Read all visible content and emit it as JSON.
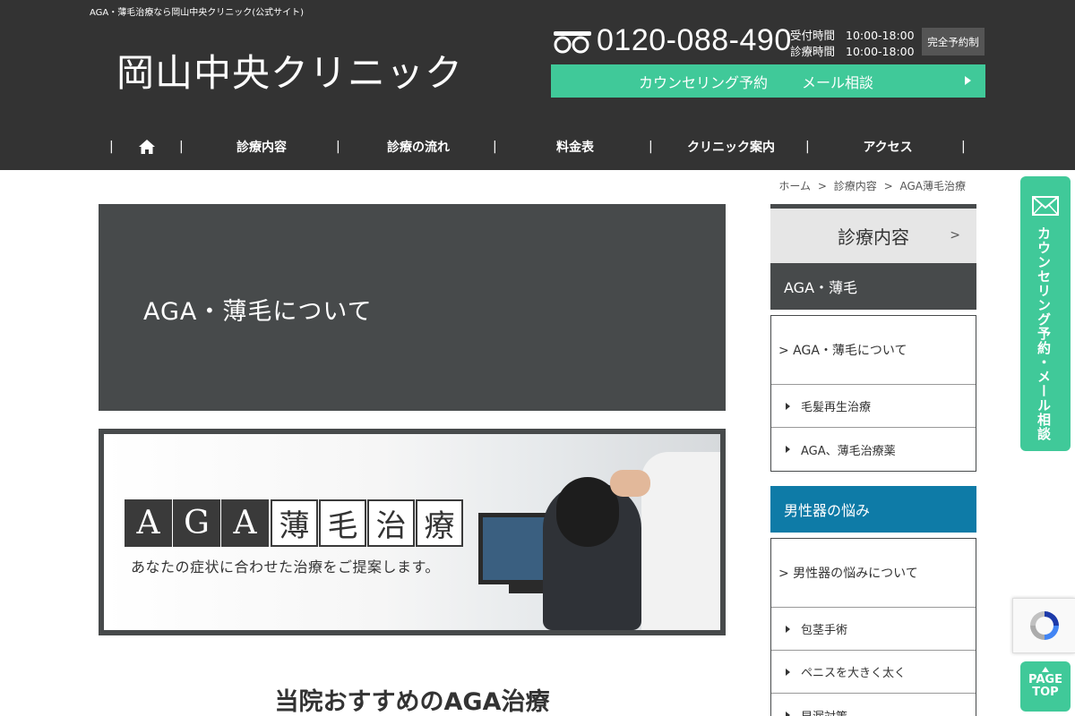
{
  "header": {
    "tagline": "AGA・薄毛治療なら岡山中央クリニック(公式サイト)",
    "logo": "岡山中央クリニック",
    "tel": "0120-088-490",
    "hours": [
      {
        "label": "受付時間",
        "value": "10:00-18:00"
      },
      {
        "label": "診療時間",
        "value": "10:00-18:00"
      }
    ],
    "reserve_badge": "完全予約制",
    "counsel_label": "カウンセリング予約",
    "mail_label": "メール相談"
  },
  "nav": {
    "items": [
      "診療内容",
      "診療の流れ",
      "料金表",
      "クリニック案内",
      "アクセス"
    ],
    "separator": "|"
  },
  "breadcrumb": {
    "items": [
      "ホーム",
      "診療内容",
      "AGA薄毛治療"
    ],
    "separator": ">"
  },
  "hero": {
    "title": "AGA・薄毛について"
  },
  "banner": {
    "title_blocks": [
      "A",
      "G",
      "A"
    ],
    "title_boxes": [
      "薄",
      "毛",
      "治",
      "療"
    ],
    "subtitle": "あなたの症状に合わせた治療をご提案します。"
  },
  "main": {
    "section_title": "当院おすすめのAGA治療"
  },
  "sidebar": {
    "heading": "診療内容",
    "heading_chevron": ">",
    "categories": [
      {
        "label": "AGA・薄毛",
        "head": "> AGA・薄毛について",
        "items": [
          "毛髪再生治療",
          "AGA、薄毛治療薬"
        ]
      },
      {
        "label": "男性器の悩み",
        "head": "> 男性器の悩みについて",
        "items": [
          "包茎手術",
          "ペニスを大きく太く",
          "早漏対策"
        ]
      }
    ]
  },
  "float": {
    "tab_text": "カウンセリング予約・メール相談",
    "page_top_1": "PAGE",
    "page_top_2": "TOP"
  },
  "colors": {
    "header_bg": "#333333",
    "accent_green": "#40c999",
    "dark_gray": "#474a4b",
    "blue": "#0e7ba7"
  },
  "icons": [
    "free-dial-icon",
    "home-icon",
    "mail-icon",
    "recaptcha-icon",
    "arrow-up-icon"
  ]
}
